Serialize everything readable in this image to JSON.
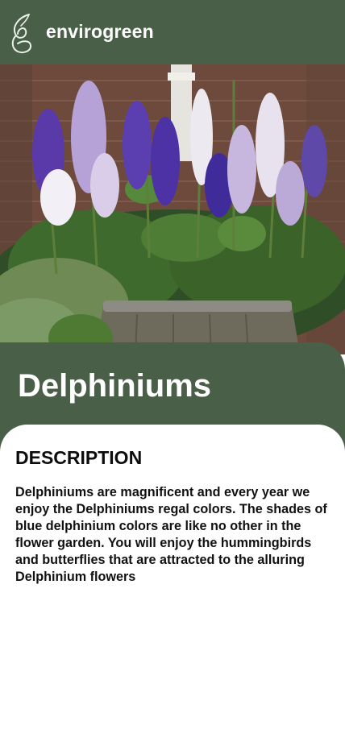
{
  "header": {
    "brand": "envirogreen",
    "logo_icon": "leaf-g-logo-icon"
  },
  "hero": {
    "image_subject": "delphinium flowers in wooden barrel planter"
  },
  "plant": {
    "name": "Delphiniums"
  },
  "description_section": {
    "heading": "DESCRIPTION",
    "body": "Delphiniums are magnificent and every year we enjoy the Delphiniums regal colors. The shades of blue delphinium colors are like no other in the flower garden. You will enjoy the hummingbirds and butterflies that are attracted to the alluring Delphinium flowers"
  },
  "colors": {
    "primary": "#4a5f48",
    "surface": "#ffffff",
    "text": "#111111"
  }
}
